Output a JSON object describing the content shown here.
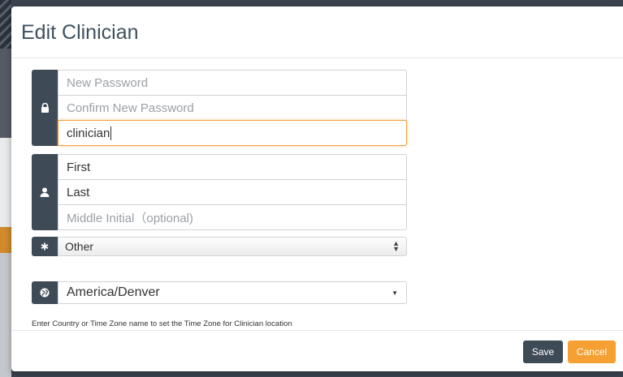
{
  "modal": {
    "title": "Edit Clinician"
  },
  "credentials": {
    "icon": "lock-icon",
    "new_password_placeholder": "New Password",
    "confirm_password_placeholder": "Confirm New Password",
    "username_value": "clinician"
  },
  "name": {
    "icon": "user-icon",
    "first_value": "First",
    "last_value": "Last",
    "middle_placeholder": "Middle Initial（optional)"
  },
  "role": {
    "icon": "asterisk-icon",
    "selected": "Other"
  },
  "timezone": {
    "helper_text": "Enter Country or Time Zone name to set the Time Zone for Clinician location",
    "icon": "globe-icon",
    "selected": "America/Denver"
  },
  "footer": {
    "save_label": "Save",
    "cancel_label": "Cancel"
  },
  "colors": {
    "addon": "#3f4a57",
    "accent_orange": "#f6a033",
    "title": "#3f5060"
  }
}
